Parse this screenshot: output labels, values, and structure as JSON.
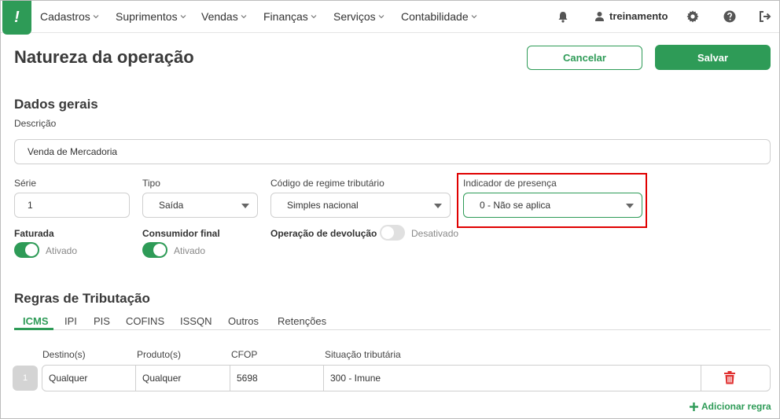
{
  "nav": {
    "items": [
      "Cadastros",
      "Suprimentos",
      "Vendas",
      "Finanças",
      "Serviços",
      "Contabilidade"
    ],
    "user": "treinamento",
    "icons": [
      "bell-icon",
      "user-icon",
      "gear-icon",
      "help-icon",
      "logout-icon"
    ]
  },
  "page": {
    "title": "Natureza da operação",
    "cancel_label": "Cancelar",
    "save_label": "Salvar"
  },
  "dados_gerais": {
    "title": "Dados gerais",
    "descricao_label": "Descrição",
    "descricao_value": "Venda de Mercadoria",
    "serie_label": "Série",
    "serie_value": "1",
    "tipo_label": "Tipo",
    "tipo_value": "Saída",
    "regime_label": "Código de regime tributário",
    "regime_value": "Simples nacional",
    "presenca_label": "Indicador de presença",
    "presenca_value": "0 - Não se aplica",
    "faturada_label": "Faturada",
    "faturada_state": "Ativado",
    "consumidor_label": "Consumidor final",
    "consumidor_state": "Ativado",
    "devolucao_label": "Operação de devolução",
    "devolucao_state": "Desativado"
  },
  "regras": {
    "title": "Regras de Tributação",
    "tabs": [
      "ICMS",
      "IPI",
      "PIS",
      "COFINS",
      "ISSQN",
      "Outros",
      "Retenções"
    ],
    "active_tab": "ICMS",
    "columns": [
      "Destino(s)",
      "Produto(s)",
      "CFOP",
      "Situação tributária"
    ],
    "rows": [
      {
        "num": "1",
        "destino": "Qualquer",
        "produto": "Qualquer",
        "cfop": "5698",
        "situacao": "300 - Imune"
      }
    ],
    "add_label": "Adicionar regra"
  },
  "colors": {
    "accent": "#2e9b57",
    "highlight": "#e00000",
    "delete": "#e03030"
  }
}
